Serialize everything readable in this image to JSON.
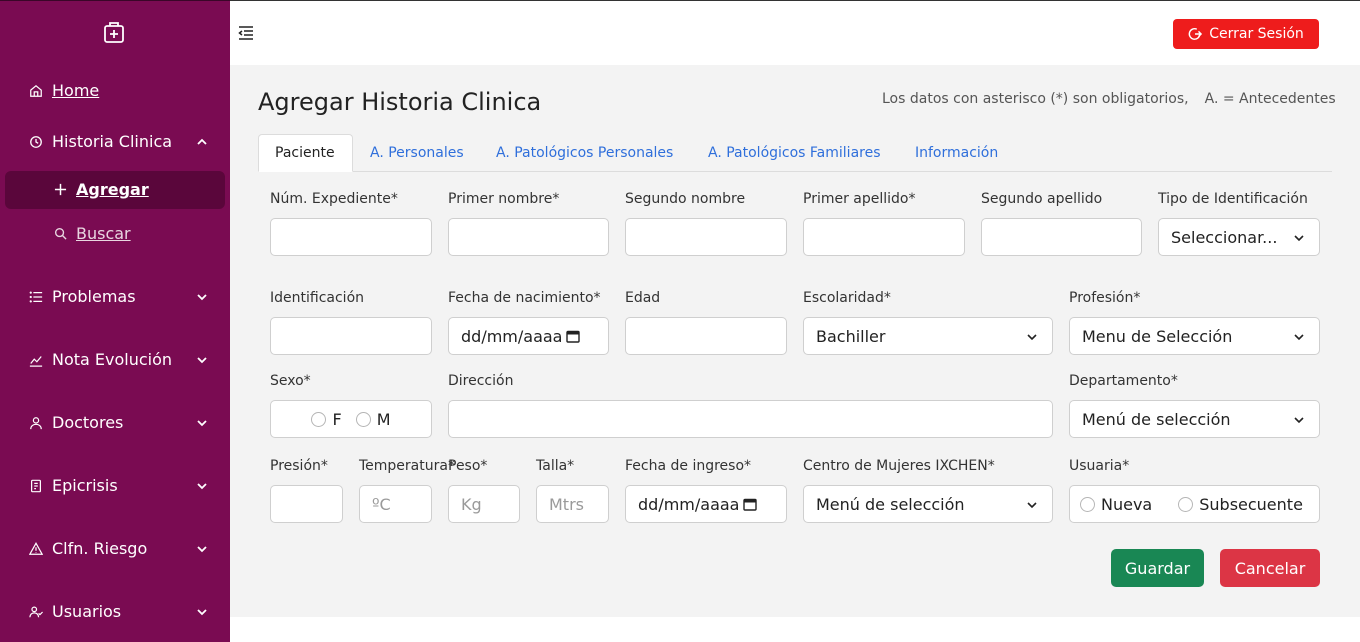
{
  "sidebar": {
    "logo_icon": "medical-bag-icon",
    "items": [
      {
        "label": "Home",
        "icon": "home-icon"
      },
      {
        "label": "Historia Clinica",
        "icon": "history-icon"
      },
      {
        "label": "Agregar",
        "icon": "plus-icon"
      },
      {
        "label": "Buscar",
        "icon": "search-icon"
      },
      {
        "label": "Problemas",
        "icon": "list-icon"
      },
      {
        "label": "Nota Evolución",
        "icon": "chart-icon"
      },
      {
        "label": "Doctores",
        "icon": "user-icon"
      },
      {
        "label": "Epicrisis",
        "icon": "report-icon"
      },
      {
        "label": "Clfn. Riesgo",
        "icon": "warning-icon"
      },
      {
        "label": "Usuarios",
        "icon": "users-icon"
      }
    ]
  },
  "topbar": {
    "logout_label": "Cerrar Sesión"
  },
  "page": {
    "title": "Agregar Historia Clinica",
    "note_required": "Los datos con asterisco (*) son obligatorios,",
    "note_abbr": "A. = Antecedentes"
  },
  "tabs": [
    "Paciente",
    "A. Personales",
    "A. Patológicos Personales",
    "A. Patológicos Familiares",
    "Información"
  ],
  "form": {
    "labels": {
      "expediente": "Núm. Expediente*",
      "primer_nombre": "Primer nombre*",
      "segundo_nombre": "Segundo nombre",
      "primer_apellido": "Primer apellido*",
      "segundo_apellido": "Segundo apellido",
      "tipo_id": "Tipo de Identificación",
      "identificacion": "Identificación",
      "fecha_nac": "Fecha de nacimiento*",
      "edad": "Edad",
      "escolaridad": "Escolaridad*",
      "profesion": "Profesión*",
      "sexo": "Sexo*",
      "direccion": "Dirección",
      "departamento": "Departamento*",
      "presion": "Presión*",
      "temperatura": "Temperatura*",
      "peso": "Peso*",
      "talla": "Talla*",
      "fecha_ingreso": "Fecha de ingreso*",
      "centro": "Centro de Mujeres IXCHEN*",
      "usuaria": "Usuaria*"
    },
    "values": {
      "tipo_id": "Seleccionar...",
      "fecha_nac": "dd/mm/aaaa",
      "escolaridad": "Bachiller",
      "profesion": "Menu de Selección",
      "departamento": "Menú de selección",
      "fecha_ingreso": "dd/mm/aaaa",
      "centro": "Menú de selección"
    },
    "placeholders": {
      "temperatura": "ºC",
      "peso": "Kg",
      "talla": "Mtrs"
    },
    "sexo_options": [
      "F",
      "M"
    ],
    "usuaria_options": [
      "Nueva",
      "Subsecuente"
    ]
  },
  "actions": {
    "save_label": "Guardar",
    "cancel_label": "Cancelar"
  },
  "colors": {
    "sidebar": "#7a0b52",
    "logout": "#ee1c1c",
    "save": "#198754",
    "cancel": "#dc3545",
    "tab_link": "#2f6fdb"
  }
}
